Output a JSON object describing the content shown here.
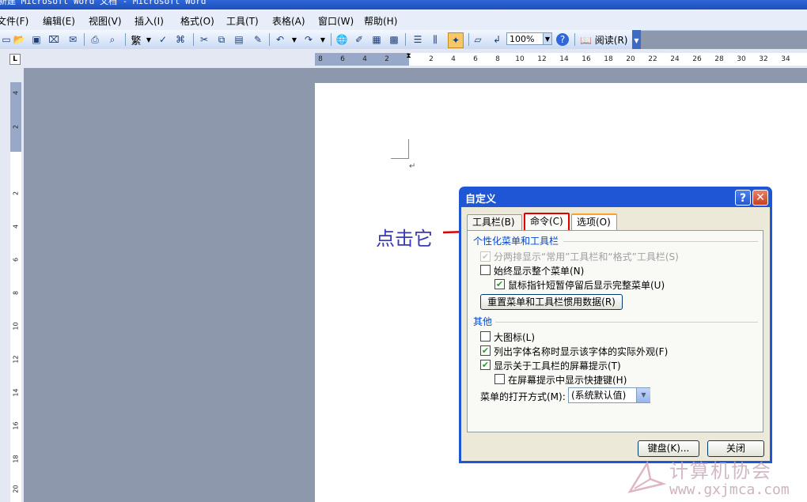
{
  "window": {
    "title": "新建 Microsoft Word 文档 - Microsoft Word"
  },
  "menu": [
    "文件(F)",
    "编辑(E)",
    "视图(V)",
    "插入(I)",
    "格式(O)",
    "工具(T)",
    "表格(A)",
    "窗口(W)",
    "帮助(H)"
  ],
  "toolbar": {
    "zoom": "100%",
    "read_label": "阅读(R)",
    "traditional": "繁"
  },
  "ruler": {
    "h_left": [
      "8",
      "6",
      "4",
      "2"
    ],
    "h_right": [
      "2",
      "4",
      "6",
      "8",
      "10",
      "12",
      "14",
      "16",
      "18",
      "20",
      "22",
      "24",
      "26",
      "28",
      "30",
      "32",
      "34"
    ],
    "v": [
      "4",
      "2",
      "2",
      "4",
      "6",
      "8",
      "10",
      "12",
      "14",
      "16",
      "18",
      "20"
    ]
  },
  "annotation": {
    "text": "点击它",
    "color": "#3838B8"
  },
  "dialog": {
    "title": "自定义",
    "tabs": [
      "工具栏(B)",
      "命令(C)",
      "选项(O)"
    ],
    "group1": "个性化菜单和工具栏",
    "options1": [
      {
        "label": "分两排显示“常用”工具栏和“格式”工具栏(S)",
        "checked": true,
        "disabled": true
      },
      {
        "label": "始终显示整个菜单(N)",
        "checked": false,
        "disabled": false
      },
      {
        "label": "鼠标指针短暂停留后显示完整菜单(U)",
        "checked": true,
        "disabled": false
      }
    ],
    "reset_button": "重置菜单和工具栏惯用数据(R)",
    "group2": "其他",
    "options2": [
      {
        "label": "大图标(L)",
        "checked": false
      },
      {
        "label": "列出字体名称时显示该字体的实际外观(F)",
        "checked": true
      },
      {
        "label": "显示关于工具栏的屏幕提示(T)",
        "checked": true
      },
      {
        "label": "在屏幕提示中显示快捷键(H)",
        "checked": false
      }
    ],
    "menu_anim_label": "菜单的打开方式(M):",
    "menu_anim_value": "(系统默认值)",
    "keyboard_button": "键盘(K)...",
    "close_button": "关闭"
  },
  "watermark": {
    "cn": "计算机协会",
    "url": "www.gxjmca.com"
  },
  "colors": {
    "accent": "#1E56D6",
    "highlight": "#E00000"
  }
}
